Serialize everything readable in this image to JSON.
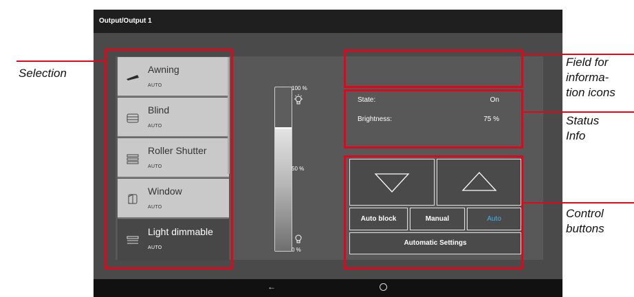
{
  "title": "Output/Output 1",
  "outputs": [
    {
      "label": "Awning",
      "mode": "AUTO",
      "icon": "awning-icon"
    },
    {
      "label": "Blind",
      "mode": "AUTO",
      "icon": "blind-icon"
    },
    {
      "label": "Roller Shutter",
      "mode": "AUTO",
      "icon": "roller-shutter-icon"
    },
    {
      "label": "Window",
      "mode": "AUTO",
      "icon": "window-icon"
    },
    {
      "label": "Light dimmable",
      "mode": "AUTO",
      "icon": "light-dimmable-icon",
      "selected": true
    }
  ],
  "slider": {
    "top_label": "100 %",
    "mid_label": "50 %",
    "bottom_label": "0 %",
    "level_percent": 75
  },
  "status": {
    "state_label": "State:",
    "state_value": "On",
    "brightness_label": "Brightness:",
    "brightness_value": "75 %"
  },
  "buttons": {
    "auto_block": "Auto block",
    "manual": "Manual",
    "auto": "Auto",
    "automatic_settings": "Automatic Settings"
  },
  "annotations": {
    "selection": "Selection",
    "info_field_1": "Field for",
    "info_field_2": "informa-",
    "info_field_3": "tion icons",
    "status_1": "Status",
    "status_2": "Info",
    "control_1": "Control",
    "control_2": "buttons"
  },
  "navigation": {
    "back_icon": "back-arrow-icon",
    "home_icon": "home-circle-icon"
  },
  "colors": {
    "annotation": "#e3061b",
    "auto_active": "#3fb7f0",
    "screen": "#4a4a4a"
  }
}
